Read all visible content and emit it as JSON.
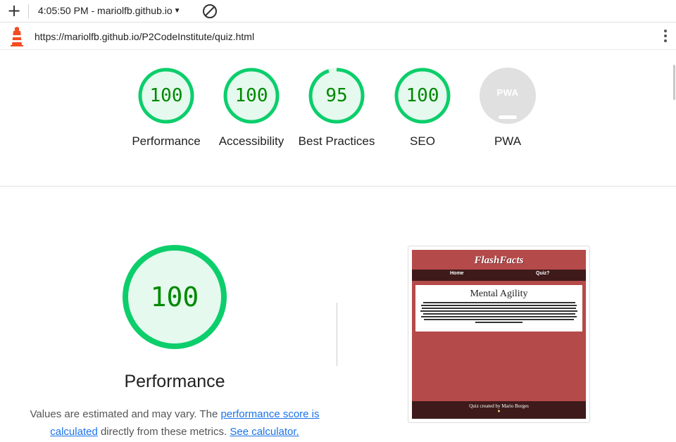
{
  "browser": {
    "new_tab_icon": "plus-icon",
    "tab_selector": "4:05:50 PM - mariolfb.github.io",
    "clear_icon": "block-icon",
    "url": "https://mariolfb.github.io/P2CodeInstitute/quiz.html",
    "menu_icon": "kebab-icon"
  },
  "scores": [
    {
      "name": "performance",
      "value": "100",
      "label": "Performance",
      "fraction": 1.0,
      "color": "#0cce6b"
    },
    {
      "name": "accessibility",
      "value": "100",
      "label": "Accessibility",
      "fraction": 1.0,
      "color": "#0cce6b"
    },
    {
      "name": "best-practices",
      "value": "95",
      "label": "Best Practices",
      "fraction": 0.95,
      "color": "#0cce6b"
    },
    {
      "name": "seo",
      "value": "100",
      "label": "SEO",
      "fraction": 1.0,
      "color": "#0cce6b"
    },
    {
      "name": "pwa",
      "value": "PWA",
      "label": "PWA",
      "fraction": 0,
      "color": "#cccccc"
    }
  ],
  "performance": {
    "score": "100",
    "title": "Performance",
    "desc_1": "Values are estimated and may vary. The ",
    "link_1": "performance score is calculated",
    "desc_2": " directly from these metrics. ",
    "link_2": "See calculator."
  },
  "screenshot": {
    "site_title": "FlashFacts",
    "nav_home": "Home",
    "nav_quiz": "Quiz?",
    "card_title": "Mental Agility",
    "footer": "Quiz created by Mario Borges",
    "brand_color": "#b54a4a",
    "nav_color": "#3e1a1a"
  }
}
